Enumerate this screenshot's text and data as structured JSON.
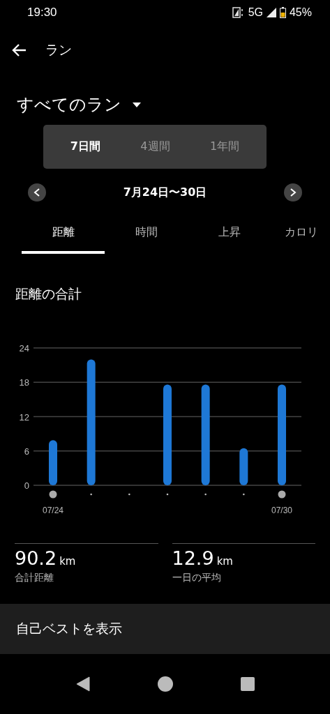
{
  "status_bar": {
    "time": "19:30",
    "network": "5G",
    "battery": "45%"
  },
  "app_bar": {
    "title": "ラン"
  },
  "filter": {
    "label": "すべてのラン"
  },
  "periods": [
    {
      "label": "7日間",
      "selected": true
    },
    {
      "label": "4週間",
      "selected": false
    },
    {
      "label": "1年間",
      "selected": false
    }
  ],
  "date_range": "7月24日〜30日",
  "metric_tabs": [
    {
      "label": "距離",
      "selected": true
    },
    {
      "label": "時間",
      "selected": false
    },
    {
      "label": "上昇",
      "selected": false
    },
    {
      "label": "カロリ",
      "selected": false
    }
  ],
  "section_title": "距離の合計",
  "chart_data": {
    "type": "bar",
    "grid": true,
    "categories": [
      "07/24",
      null,
      null,
      null,
      null,
      null,
      "07/30"
    ],
    "series": [
      {
        "color": "#1e78d6",
        "values": [
          7.9,
          22.0,
          0,
          17.6,
          17.6,
          6.5,
          17.6
        ]
      }
    ],
    "ylim": [
      0,
      24
    ],
    "yticks": [
      0,
      6,
      12,
      18,
      24
    ]
  },
  "stats": [
    {
      "value": "90.2",
      "unit": "km",
      "label": "合計距離"
    },
    {
      "value": "12.9",
      "unit": "km",
      "label": "一日の平均"
    }
  ],
  "best_button": "自己ベストを表示"
}
